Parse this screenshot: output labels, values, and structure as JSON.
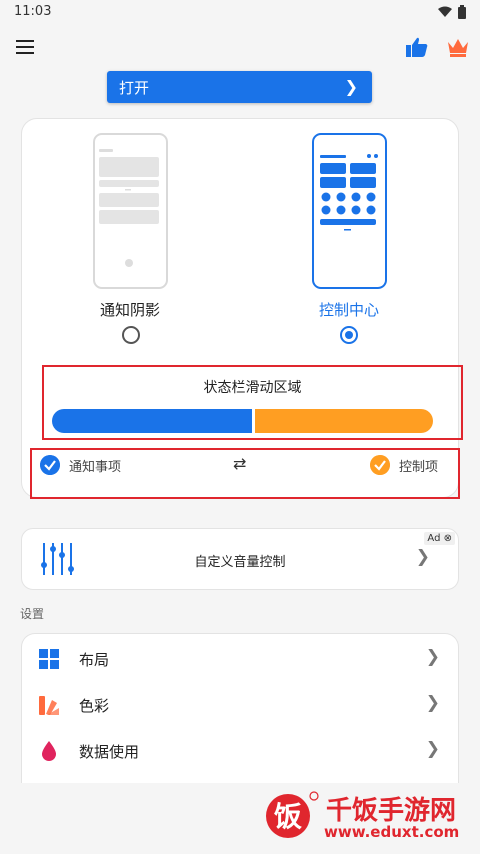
{
  "status_bar": {
    "time": "11:03"
  },
  "open_banner": {
    "label": "打开"
  },
  "options": {
    "left_label": "通知阴影",
    "right_label": "控制中心",
    "selected": "right"
  },
  "zone": {
    "title": "状态栏滑动区域",
    "left_color": "#1a73e8",
    "right_color": "#ff9e22",
    "split_fraction": 0.53
  },
  "swap": {
    "left_label": "通知事项",
    "right_label": "控制项"
  },
  "ad": {
    "badge": "Ad",
    "label": "自定义音量控制"
  },
  "settings": {
    "section_title": "设置",
    "items": [
      {
        "label": "布局",
        "icon": "grid-icon"
      },
      {
        "label": "色彩",
        "icon": "palette-icon"
      },
      {
        "label": "数据使用",
        "icon": "drop-icon"
      }
    ]
  },
  "watermark": {
    "title": "千饭手游网",
    "url": "www.eduxt.com"
  },
  "colors": {
    "accent": "#1a73e8",
    "orange": "#ff9e22",
    "highlight_red": "#e0262e"
  }
}
